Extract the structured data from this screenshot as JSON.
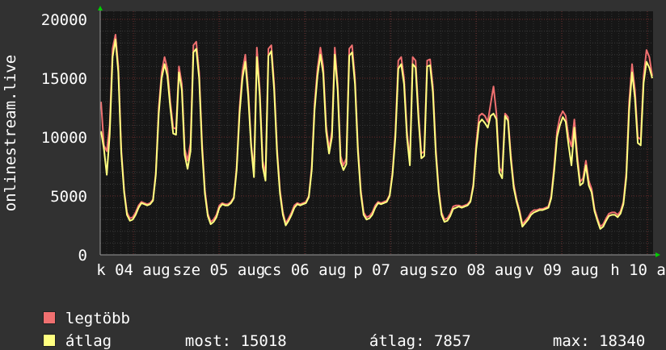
{
  "chart_data": {
    "type": "line",
    "ylabel": "onlinestream.live",
    "ylim": [
      0,
      20000
    ],
    "yticks": [
      0,
      5000,
      10000,
      15000,
      20000
    ],
    "grid": true,
    "x_tick_labels": [
      "k 04 aug",
      "sze 05 aug",
      "cs 06 aug",
      "p 07 aug",
      "szo 08 aug",
      "v 09 aug",
      "h 10 aug"
    ],
    "series": [
      {
        "name": "legtöbb",
        "color": "#f07070",
        "values": [
          13000,
          9300,
          8800,
          11000,
          17500,
          18700,
          16000,
          9000,
          5500,
          3600,
          3100,
          3200,
          3600,
          4200,
          4500,
          4400,
          4300,
          4400,
          4700,
          7000,
          12500,
          15500,
          16800,
          15800,
          13000,
          10800,
          10700,
          16000,
          14500,
          9000,
          8000,
          9500,
          17800,
          18100,
          15500,
          9500,
          5500,
          3500,
          2800,
          3000,
          3400,
          4200,
          4400,
          4300,
          4300,
          4500,
          4900,
          7500,
          12500,
          15600,
          17000,
          14000,
          9500,
          7000,
          17600,
          14000,
          8000,
          6800,
          17500,
          17800,
          14500,
          9000,
          5500,
          3600,
          2700,
          3100,
          3600,
          4200,
          4400,
          4300,
          4400,
          4500,
          5000,
          7500,
          12800,
          15800,
          17600,
          16000,
          11000,
          9000,
          10500,
          17600,
          14500,
          8400,
          7600,
          8200,
          17500,
          17800,
          15000,
          9200,
          5500,
          3600,
          3200,
          3300,
          3600,
          4200,
          4500,
          4400,
          4500,
          4600,
          5100,
          7000,
          10500,
          16500,
          16800,
          15000,
          10500,
          8000,
          16800,
          16500,
          12000,
          8600,
          8800,
          16500,
          16600,
          14300,
          9000,
          5600,
          3600,
          3000,
          3100,
          3500,
          4100,
          4200,
          4200,
          4100,
          4200,
          4300,
          4600,
          6000,
          9500,
          11800,
          12000,
          11800,
          11300,
          12800,
          14300,
          12000,
          7400,
          7000,
          12000,
          11700,
          8500,
          6000,
          4700,
          3800,
          2600,
          2900,
          3200,
          3600,
          3800,
          3800,
          3900,
          3900,
          4000,
          4100,
          5000,
          7500,
          10500,
          11700,
          12200,
          11800,
          10000,
          9200,
          11500,
          8500,
          6200,
          6500,
          8000,
          6300,
          5600,
          3900,
          3100,
          2400,
          2600,
          3100,
          3500,
          3600,
          3600,
          3400,
          3700,
          4500,
          7000,
          13000,
          16200,
          14000,
          10000,
          9800,
          15200,
          17400,
          16800,
          15200
        ]
      },
      {
        "name": "átlag",
        "color": "#ffff80",
        "values": [
          10500,
          9000,
          6800,
          10200,
          16800,
          18300,
          15500,
          8700,
          5300,
          3400,
          2900,
          3000,
          3400,
          4000,
          4400,
          4300,
          4200,
          4300,
          4600,
          6800,
          12000,
          15000,
          16200,
          15200,
          12500,
          10300,
          10200,
          15500,
          14000,
          8500,
          7300,
          8800,
          17200,
          17500,
          15000,
          9000,
          5200,
          3300,
          2600,
          2800,
          3200,
          4000,
          4300,
          4200,
          4200,
          4400,
          4800,
          7200,
          12000,
          15000,
          16400,
          13500,
          9200,
          6600,
          16800,
          13500,
          7500,
          6300,
          16900,
          17300,
          14000,
          8600,
          5200,
          3400,
          2500,
          2900,
          3400,
          4000,
          4300,
          4200,
          4300,
          4400,
          4900,
          7200,
          12300,
          15200,
          17000,
          15400,
          10500,
          8600,
          10000,
          17000,
          14000,
          7900,
          7200,
          7700,
          16900,
          17200,
          14500,
          8800,
          5200,
          3400,
          3000,
          3100,
          3400,
          4000,
          4400,
          4300,
          4400,
          4500,
          5000,
          6800,
          10000,
          15800,
          16200,
          14500,
          10000,
          7600,
          16200,
          15900,
          11500,
          8200,
          8400,
          16000,
          16100,
          13800,
          8600,
          5300,
          3400,
          2800,
          2900,
          3300,
          3900,
          4000,
          4100,
          4000,
          4100,
          4200,
          4500,
          5800,
          9000,
          11200,
          11500,
          11200,
          10800,
          11800,
          12000,
          11500,
          7000,
          6500,
          11800,
          11400,
          8100,
          5700,
          4500,
          3600,
          2400,
          2700,
          3000,
          3400,
          3600,
          3700,
          3800,
          3800,
          3900,
          4000,
          4800,
          7100,
          10000,
          11000,
          11700,
          11300,
          9300,
          7600,
          10800,
          8000,
          5900,
          6100,
          7600,
          5900,
          5300,
          3700,
          2900,
          2200,
          2400,
          2900,
          3300,
          3400,
          3400,
          3200,
          3500,
          4300,
          6600,
          12300,
          15500,
          13300,
          9500,
          9300,
          14600,
          16400,
          15900,
          15000
        ]
      }
    ]
  },
  "legend": [
    {
      "label": "legtöbb",
      "color": "#f07070"
    },
    {
      "label": "átlag",
      "color": "#ffff80"
    }
  ],
  "stats": {
    "current_label": "most:",
    "current_value": "15018",
    "average_label": "átlag:",
    "average_value": "7857",
    "max_label": "max:",
    "max_value": "18340"
  }
}
